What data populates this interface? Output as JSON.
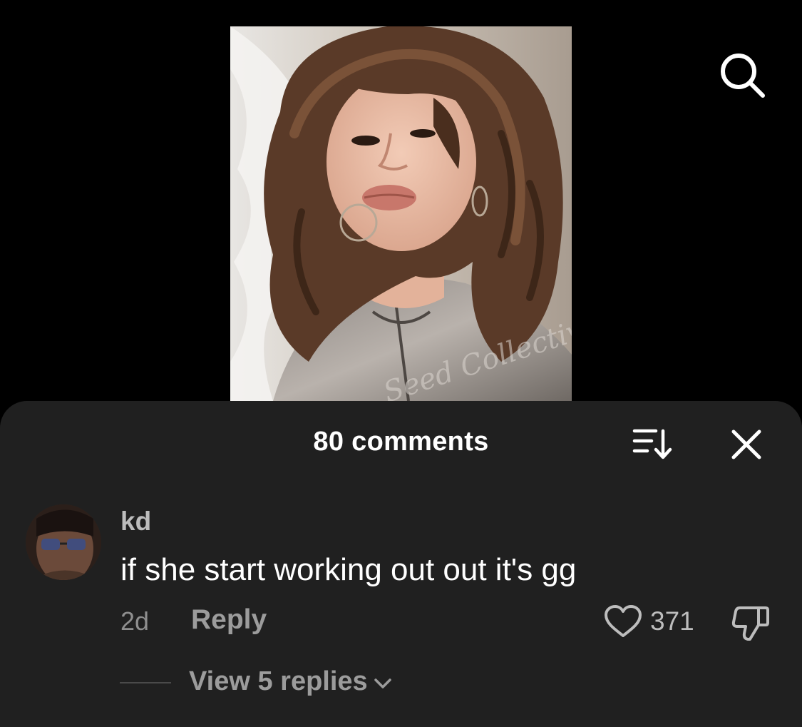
{
  "video": {
    "overlay_text": "Seed Collective"
  },
  "header": {
    "search_icon": "search-icon"
  },
  "comments": {
    "title": "80 comments",
    "sort_icon": "sort-icon",
    "close_icon": "close-icon",
    "items": [
      {
        "username": "kd",
        "text": "if she start working out out it's gg",
        "age": "2d",
        "reply_label": "Reply",
        "like_count": "371",
        "view_replies_label": "View 5 replies"
      }
    ]
  },
  "colors": {
    "background": "#000000",
    "sheet": "#202020",
    "primary_text": "#ffffff",
    "secondary_text": "#9c9c9c"
  }
}
